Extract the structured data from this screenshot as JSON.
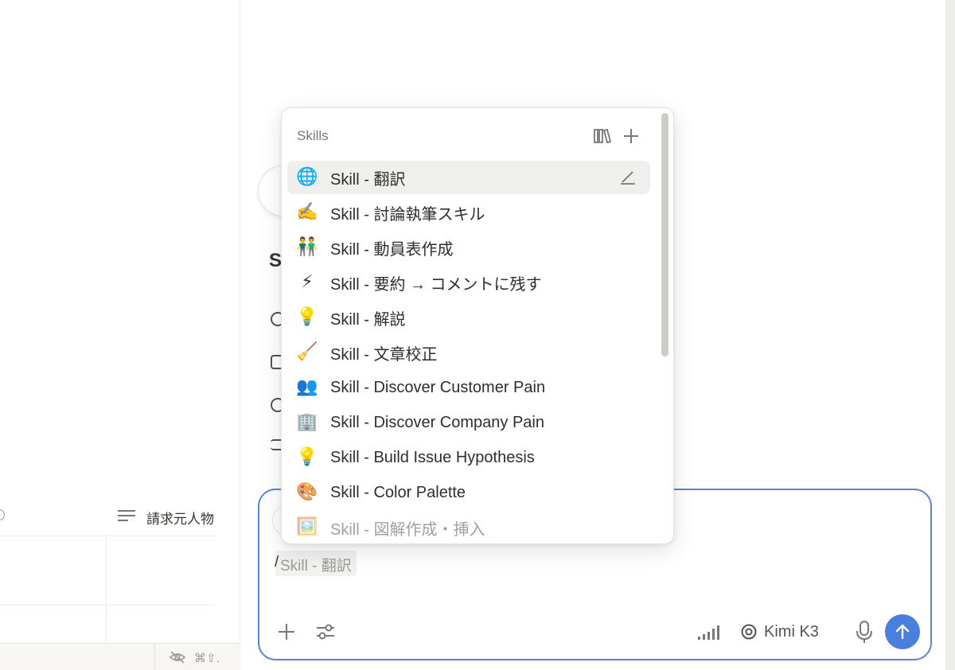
{
  "left_pane": {
    "column_label": "請求元人物",
    "shortcut": "⌘⇧."
  },
  "background": {
    "heading_initial": "S"
  },
  "skills_menu": {
    "title": "Skills",
    "items": [
      {
        "emoji": "🌐",
        "label": "Skill - 翻訳",
        "selected": true
      },
      {
        "emoji": "✍️",
        "label": "Skill - 討論執筆スキル"
      },
      {
        "emoji": "👬",
        "label": "Skill - 動員表作成"
      },
      {
        "emoji": "⚡",
        "label": "Skill - 要約 → コメントに残す"
      },
      {
        "emoji": "💡",
        "label": "Skill - 解説"
      },
      {
        "emoji": "🧹",
        "label": "Skill - 文章校正"
      },
      {
        "emoji": "👥",
        "label": "Skill - Discover Customer Pain"
      },
      {
        "emoji": "🏢",
        "label": "Skill - Discover Company Pain"
      },
      {
        "emoji": "💡",
        "label": "Skill - Build Issue Hypothesis"
      },
      {
        "emoji": "🎨",
        "label": "Skill - Color Palette"
      },
      {
        "emoji": "🖼️",
        "label": "Skill - 図解作成・挿入"
      }
    ]
  },
  "chat_input": {
    "typed": "/",
    "suggestion": "Skill - 翻訳",
    "model_name": "Kimi K3"
  },
  "colors": {
    "accent": "#4a7fde",
    "focus_border": "#5a85d6"
  },
  "icons": [
    "library-icon",
    "plus-icon",
    "edit-icon",
    "settings-sliders-icon",
    "signal-icon",
    "model-target-icon",
    "microphone-icon",
    "arrow-up-icon",
    "eye-off-icon"
  ]
}
